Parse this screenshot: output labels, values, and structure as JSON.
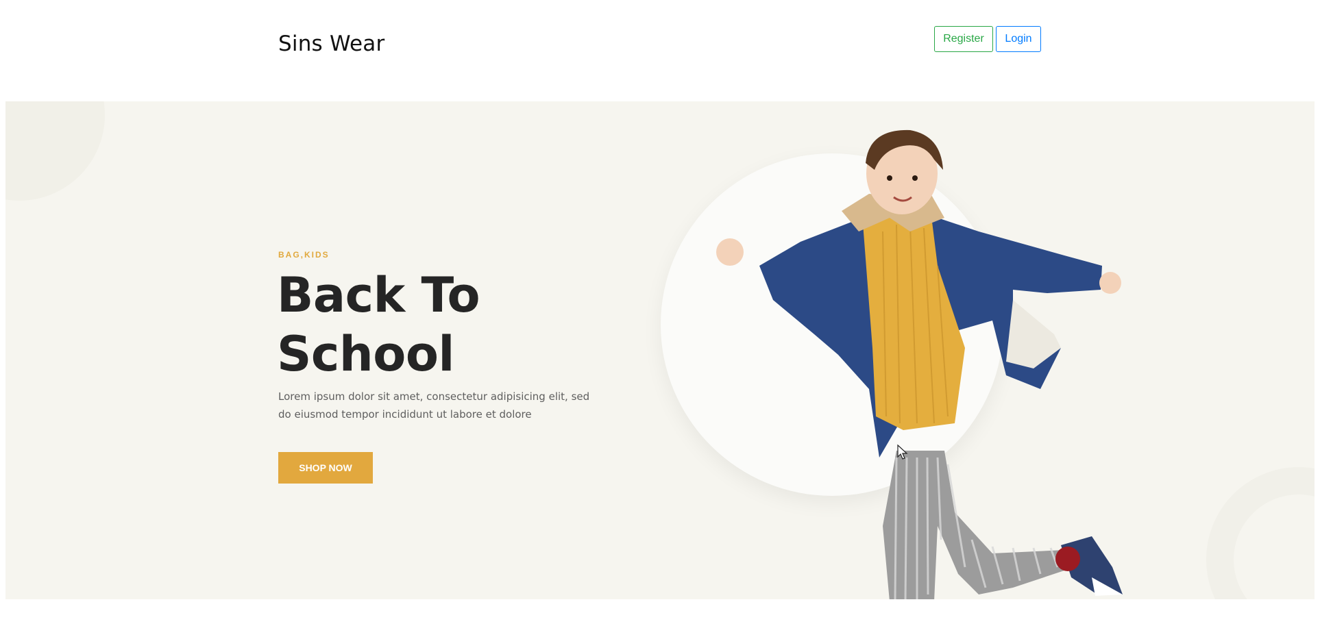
{
  "header": {
    "brand": "Sins Wear",
    "register_label": "Register",
    "login_label": "Login"
  },
  "hero": {
    "tag": "BAG,KIDS",
    "title_line1": "Back To",
    "title_line2": "School",
    "description": "Lorem ipsum dolor sit amet, consectetur adipisicing elit, sed do eiusmod tempor incididunt ut labore et dolore",
    "cta_label": "SHOP NOW"
  },
  "colors": {
    "accent": "#e2a83e",
    "hero_bg": "#f6f5ef",
    "register": "#28a745",
    "login": "#007bff",
    "heading": "#252525"
  },
  "icons": {
    "cursor": "mouse-pointer-icon"
  }
}
